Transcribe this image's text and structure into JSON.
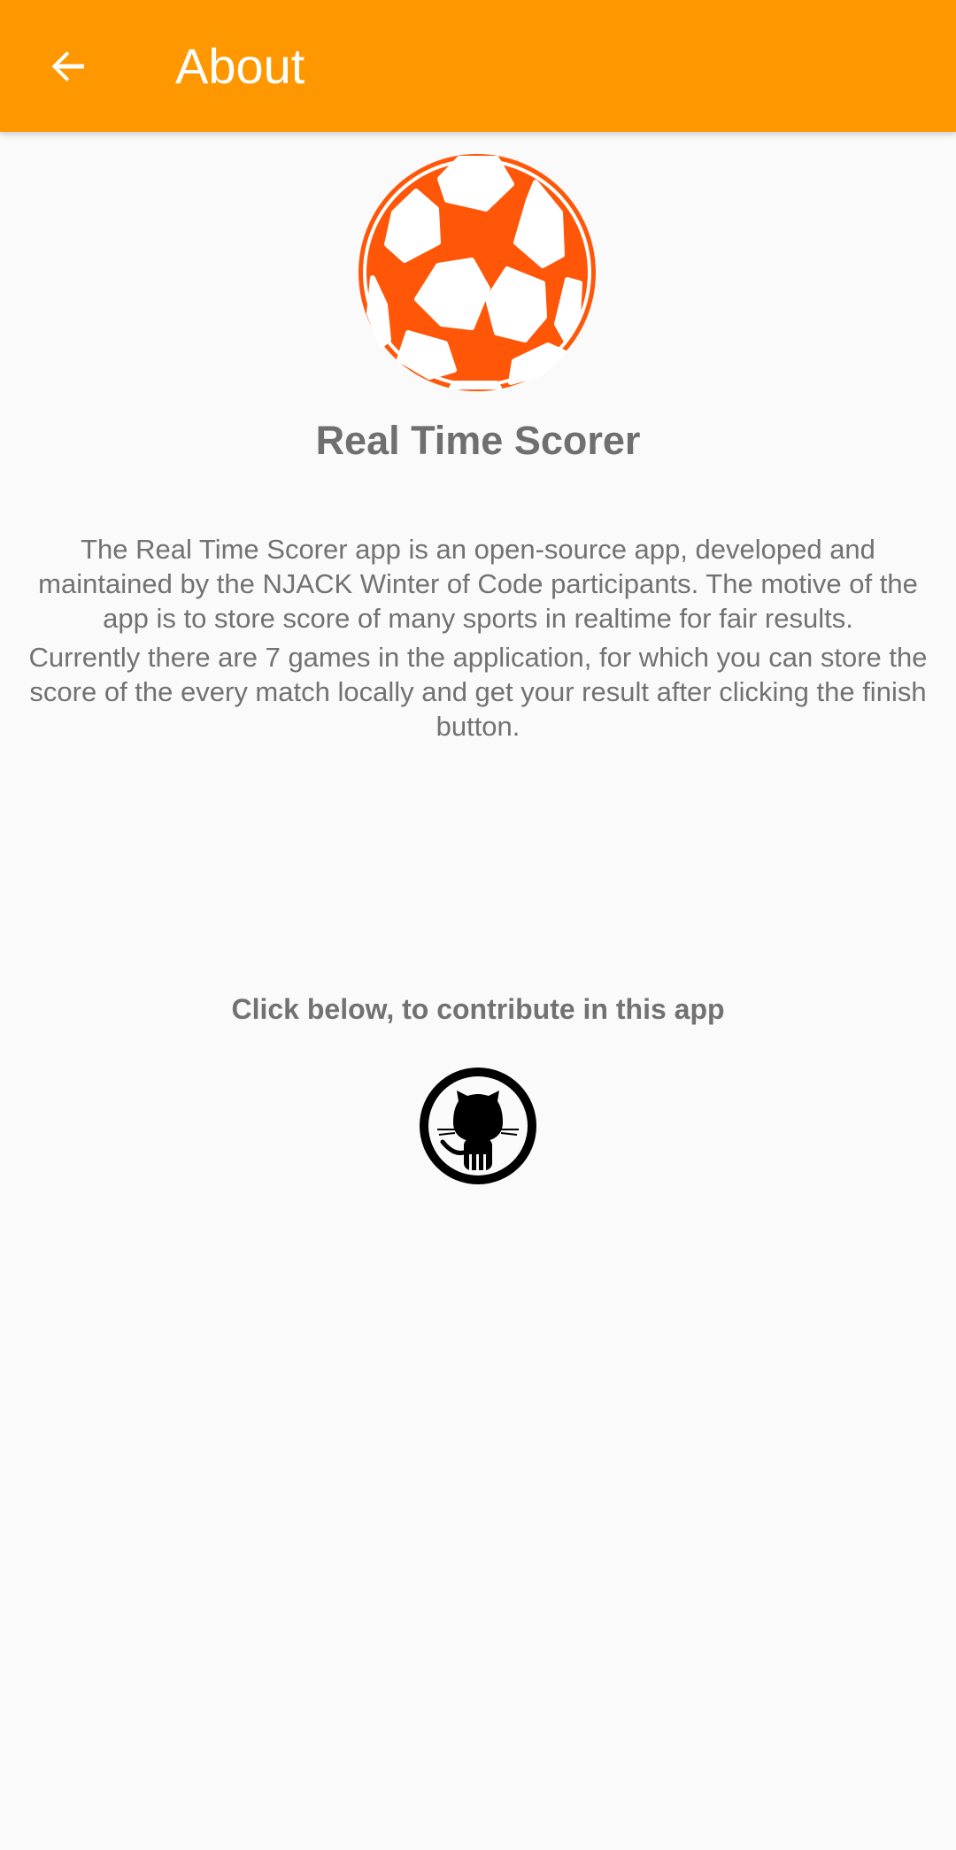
{
  "appbar": {
    "title": "About",
    "back_icon": "arrow-back-icon",
    "background_color": "#ff9800"
  },
  "app": {
    "logo_icon": "soccer-ball-icon",
    "logo_color": "#ff5608",
    "name": "Real Time Scorer",
    "description_paragraphs": [
      "The Real Time Scorer app is an open-source app, developed and maintained by the NJACK Winter of Code participants. The motive of the app is to store score of many sports in realtime for fair results.",
      "Currently there are 7 games in the application, for which you can store the score of the every match locally and get your result after clicking the finish button."
    ]
  },
  "contribute": {
    "label": "Click below, to contribute in this app",
    "github_icon": "github-icon"
  }
}
